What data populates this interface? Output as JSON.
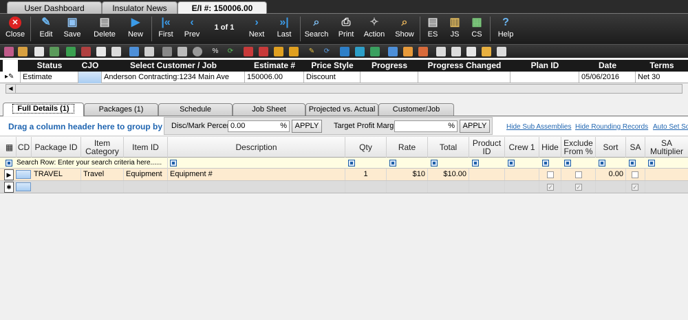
{
  "window_tabs": [
    "User Dashboard",
    "Insulator News",
    "E/I #: 150006.00"
  ],
  "toolbar": {
    "buttons": [
      "Close",
      "Edit",
      "Save",
      "Delete",
      "New",
      "First",
      "Prev",
      "Next",
      "Last",
      "Search",
      "Print",
      "Action",
      "Show",
      "ES",
      "JS",
      "CS",
      "Help"
    ],
    "page_count": "1 of 1"
  },
  "estimate_header": {
    "columns": [
      "Status",
      "CJO",
      "Select Customer / Job",
      "Estimate #",
      "Price Style",
      "Progress",
      "Progress Changed",
      "Plan ID",
      "Date",
      "Terms"
    ],
    "row": {
      "status": "Estimate",
      "cjo": "",
      "customer_job": "Anderson Contracting:1234 Main Ave",
      "estimate_no": "150006.00",
      "price_style": "Discount",
      "progress": "",
      "progress_changed": "",
      "plan_id": "",
      "date": "05/06/2016",
      "terms": "Net 30"
    }
  },
  "detail_tabs": [
    "Full Details  (1)",
    "Packages  (1)",
    "Schedule",
    "Job Sheet",
    "Projected vs. Actual",
    "Customer/Job"
  ],
  "group_bar": {
    "text": "Drag a column header here to group by that column",
    "disc_label": "Disc/Mark Percent:",
    "disc_value": "0.00",
    "pct": "%",
    "apply": "APPLY",
    "margin_label": "Target Profit Margin:",
    "margin_value": "",
    "links": [
      "Hide Sub Assemblies",
      "Hide Rounding Records",
      "Auto Set Sort"
    ]
  },
  "detail_grid": {
    "columns": [
      "CD",
      "Package ID",
      "Item Category",
      "Item ID",
      "Description",
      "Qty",
      "Rate",
      "Total",
      "Product ID",
      "Crew 1",
      "Hide",
      "Exclude From %",
      "Sort",
      "SA",
      "SA Multiplier"
    ],
    "search_row_text": "Search Row: Enter your search criteria here......",
    "rows": [
      {
        "package_id": "TRAVEL",
        "item_category": "Travel",
        "item_id": "Equipment",
        "description": "Equipment #",
        "qty": "1",
        "rate": "$10",
        "total": "$10.00",
        "product_id": "",
        "crew1": "",
        "sort": "0.00"
      }
    ],
    "new_row_marker": "✱"
  }
}
